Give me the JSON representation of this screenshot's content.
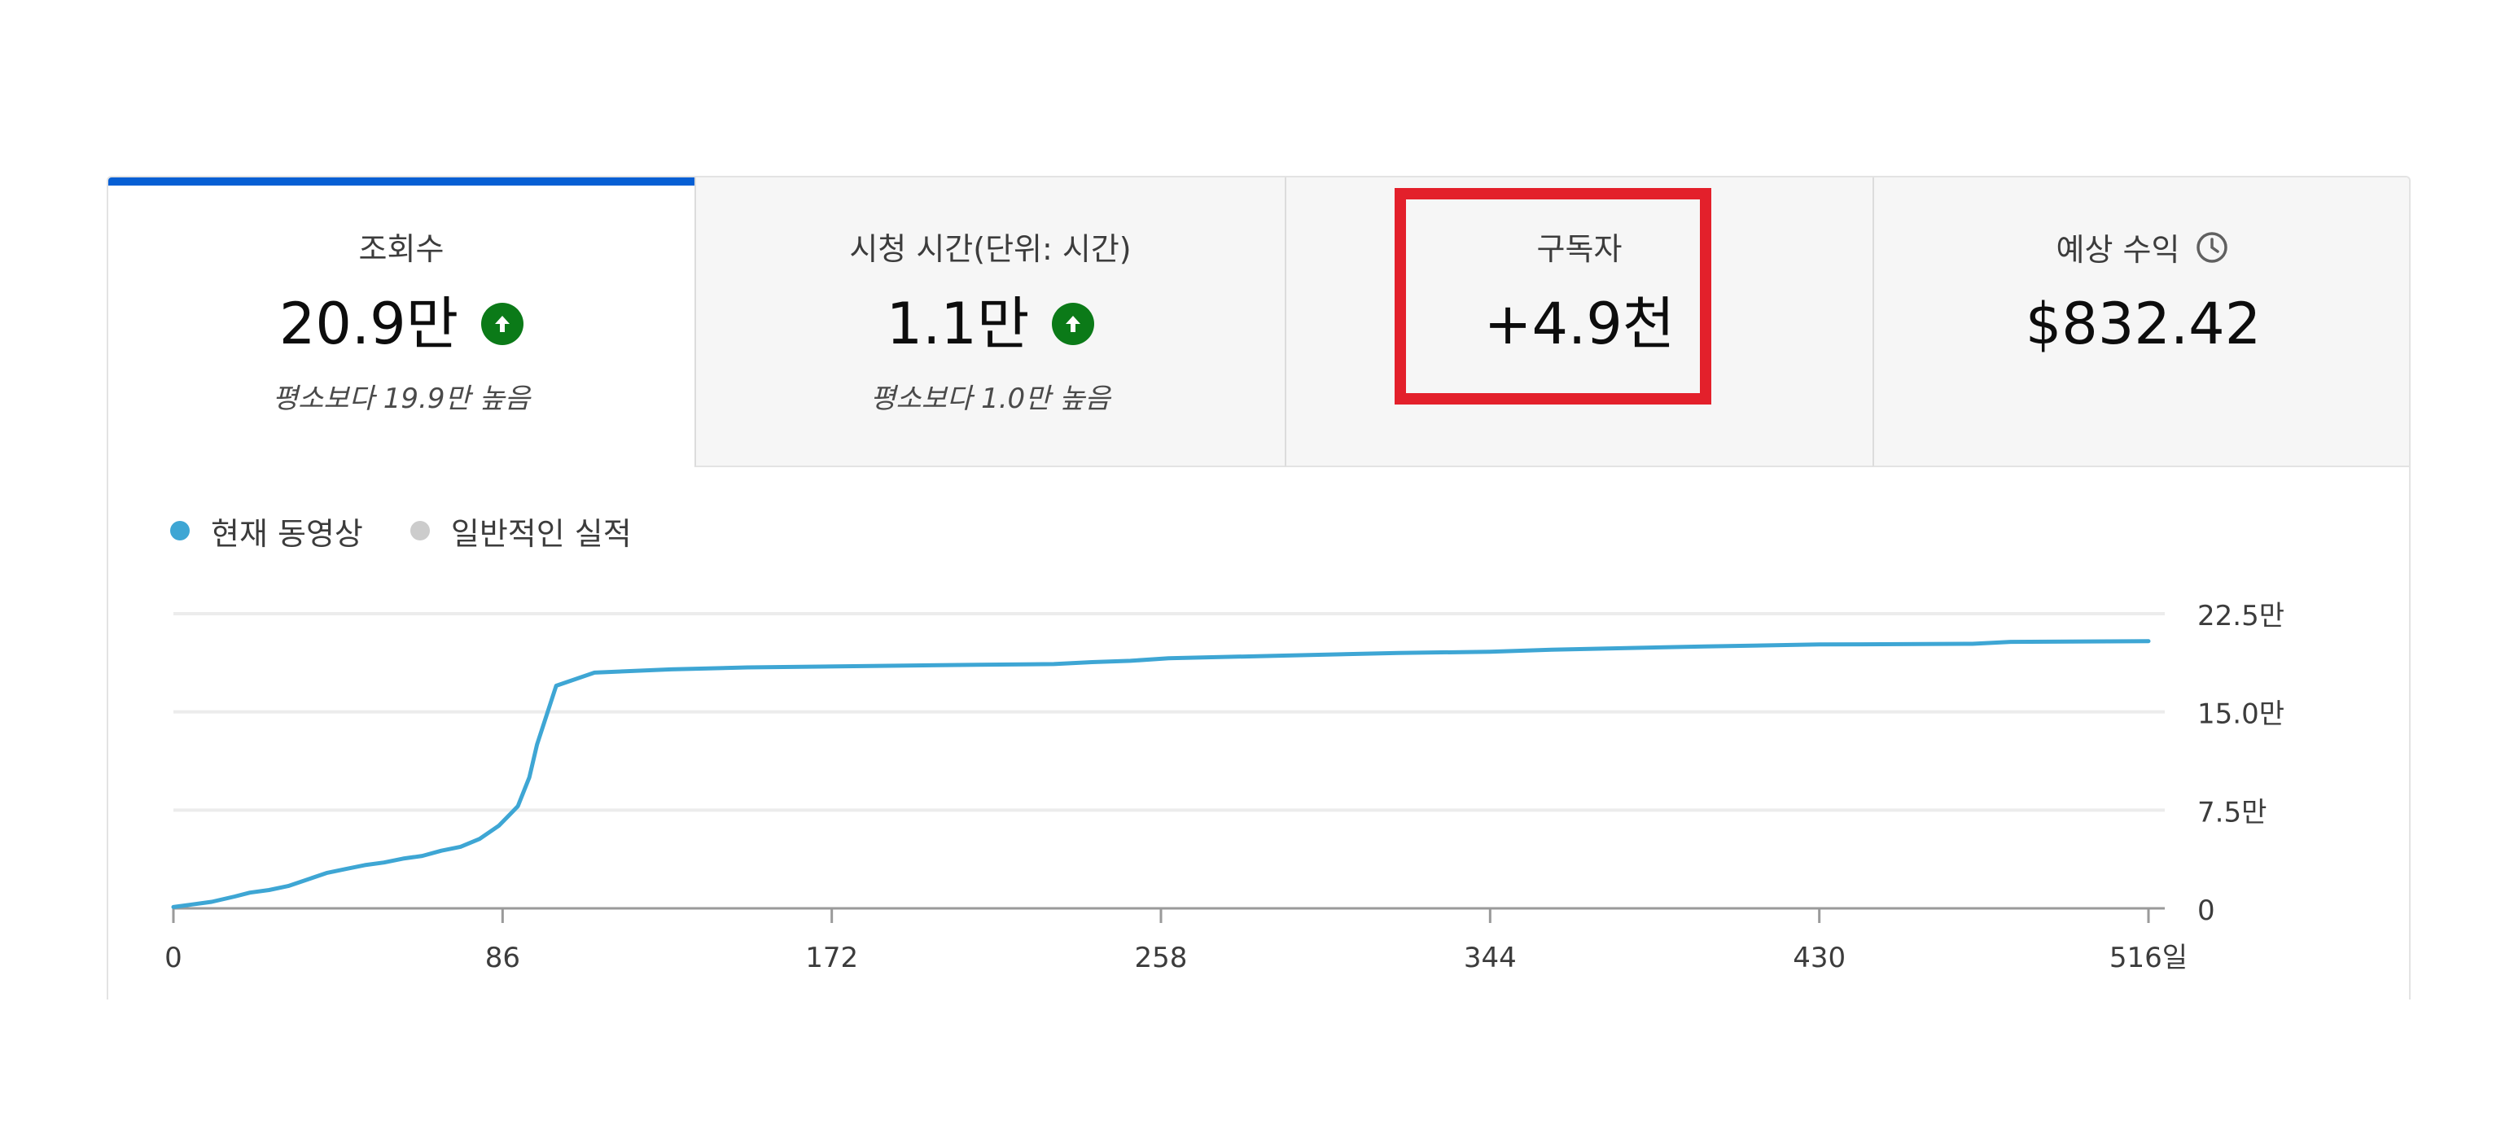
{
  "tabs": [
    {
      "label": "조회수",
      "value": "20.9만",
      "trend": "up",
      "comparison": "평소보다 19.9만 높음",
      "selected": true
    },
    {
      "label": "시청 시간(단위: 시간)",
      "value": "1.1만",
      "trend": "up",
      "comparison": "평소보다 1.0만 높음",
      "selected": false
    },
    {
      "label": "구독자",
      "value": "+4.9천",
      "selected": false,
      "highlighted": true
    },
    {
      "label": "예상 수익",
      "value": "$832.42",
      "icon": "clock-icon",
      "selected": false
    }
  ],
  "legend": [
    {
      "label": "현재 동영상",
      "color": "#3ea6d4"
    },
    {
      "label": "일반적인 실적",
      "color": "#cccccc"
    }
  ],
  "colors": {
    "accent": "#065fd4",
    "trend_up": "#0b7a18",
    "series": "#3ea6d4",
    "highlight": "#e3202b"
  },
  "chart_data": {
    "type": "line",
    "x_unit": "일",
    "xlim": [
      0,
      516
    ],
    "ylim": [
      0,
      225000
    ],
    "x_ticks": [
      {
        "value": 0,
        "label": "0"
      },
      {
        "value": 86,
        "label": "86"
      },
      {
        "value": 172,
        "label": "172"
      },
      {
        "value": 258,
        "label": "258"
      },
      {
        "value": 344,
        "label": "344"
      },
      {
        "value": 430,
        "label": "430"
      },
      {
        "value": 516,
        "label": "516일"
      }
    ],
    "y_ticks": [
      {
        "value": 0,
        "label": "0"
      },
      {
        "value": 75000,
        "label": "7.5만"
      },
      {
        "value": 150000,
        "label": "15.0만"
      },
      {
        "value": 225000,
        "label": "22.5만"
      }
    ],
    "grid": true,
    "series": [
      {
        "name": "현재 동영상",
        "x": [
          0,
          5,
          10,
          16,
          20,
          25,
          30,
          35,
          40,
          45,
          50,
          55,
          60,
          65,
          70,
          75,
          80,
          85,
          88,
          90,
          93,
          95,
          100,
          110,
          130,
          150,
          180,
          210,
          230,
          240,
          250,
          260,
          290,
          320,
          344,
          360,
          400,
          430,
          470,
          480,
          516
        ],
        "y": [
          1000,
          3000,
          5000,
          9000,
          12000,
          14000,
          17000,
          22000,
          27000,
          30000,
          33000,
          35000,
          38000,
          40000,
          44000,
          47000,
          53000,
          63000,
          72000,
          78000,
          100000,
          125000,
          170000,
          180000,
          182500,
          184000,
          185000,
          186000,
          186500,
          188000,
          189000,
          191000,
          193000,
          195000,
          196000,
          197500,
          200000,
          201500,
          202000,
          203500,
          204000
        ]
      }
    ]
  }
}
